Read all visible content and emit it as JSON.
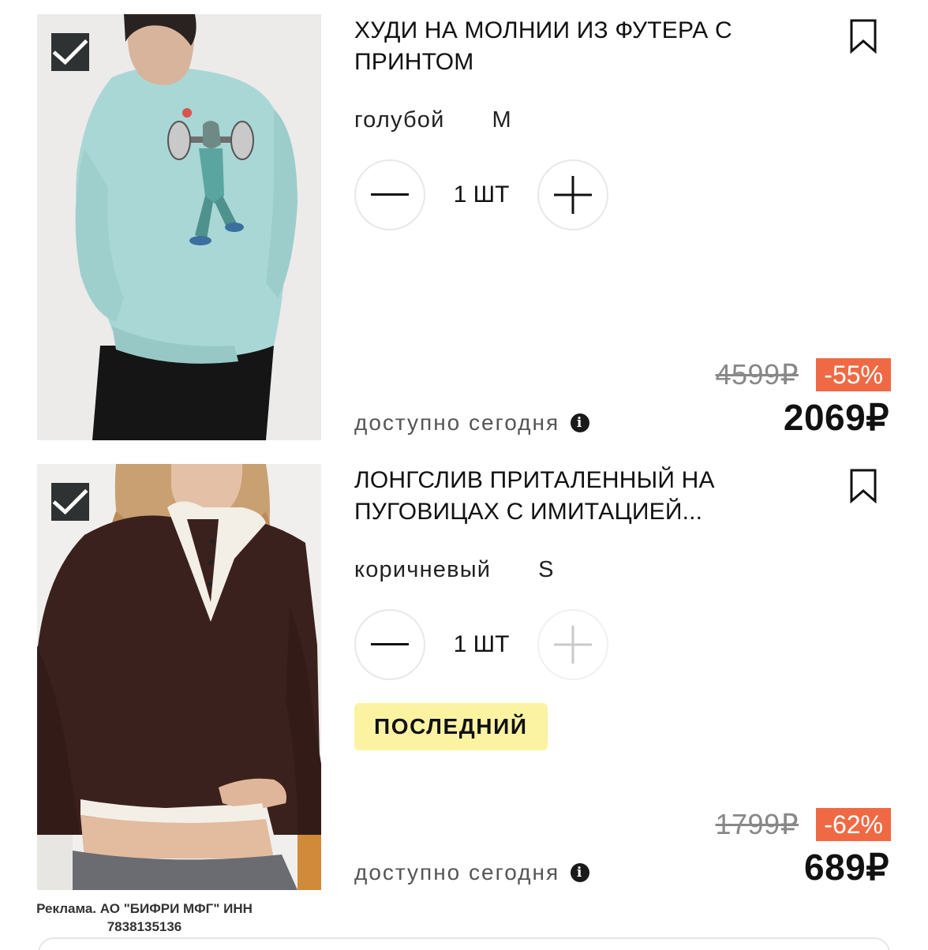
{
  "currency_sign": "₽",
  "items": [
    {
      "title": "ХУДИ НА МОЛНИИ ИЗ ФУТЕРА С ПРИНТОМ",
      "color": "голубой",
      "size": "M",
      "quantity": "1 ШТ",
      "availability": "доступно сегодня",
      "old_price": "4599₽",
      "discount": "-55%",
      "price": "2069₽",
      "selected": true
    },
    {
      "title": "ЛОНГСЛИВ ПРИТАЛЕННЫЙ НА ПУГОВИЦАХ С ИМИТАЦИЕЙ...",
      "color": "коричневый",
      "size": "S",
      "quantity": "1 ШТ",
      "badge": "ПОСЛЕДНИЙ",
      "availability": "доступно сегодня",
      "old_price": "1799₽",
      "discount": "-62%",
      "price": "689₽",
      "selected": true
    }
  ],
  "ad_note": "Реклама. АО \"БИФРИ МФГ\" ИНН 7838135136",
  "colors": {
    "discount_bg": "#ef6a44",
    "badge_bg": "#fbf3a2",
    "checkbox_bg": "#2f3232"
  },
  "icons": [
    "checkmark-icon",
    "bookmark-icon",
    "minus-icon",
    "plus-icon",
    "info-icon"
  ]
}
